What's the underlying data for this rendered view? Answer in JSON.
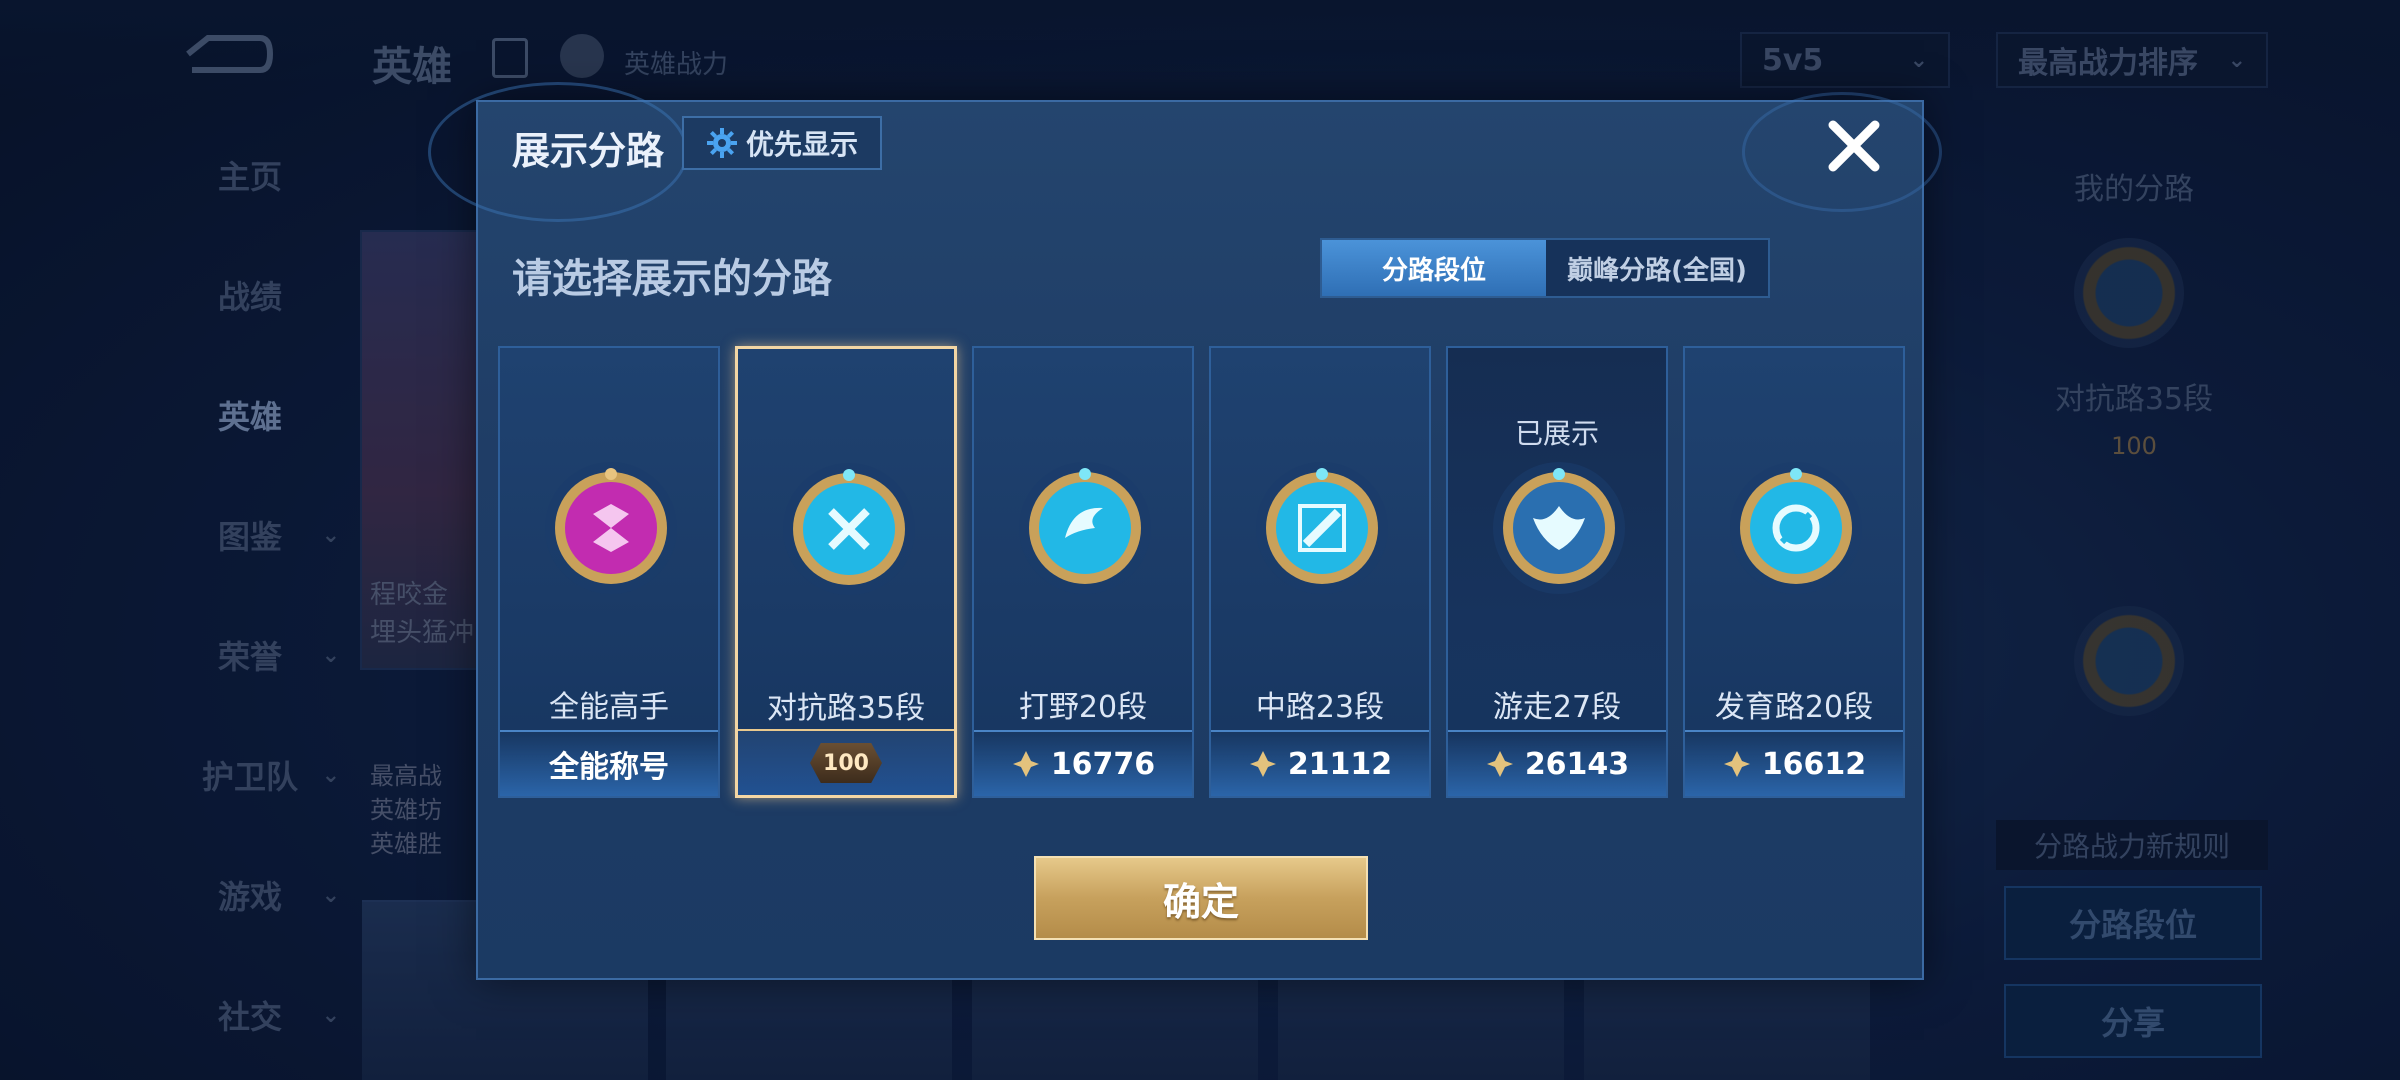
{
  "background": {
    "title": "英雄",
    "subtitle": "英雄战力",
    "mode_select": "5v5",
    "sort_select": "最高战力排序",
    "nav": [
      {
        "label": "主页",
        "has_chevron": false
      },
      {
        "label": "战绩",
        "has_chevron": false
      },
      {
        "label": "英雄",
        "has_chevron": false,
        "active": true
      },
      {
        "label": "图鉴",
        "has_chevron": true
      },
      {
        "label": "荣誉",
        "has_chevron": true
      },
      {
        "label": "护卫队",
        "has_chevron": true
      },
      {
        "label": "游戏",
        "has_chevron": true
      },
      {
        "label": "社交",
        "has_chevron": true
      }
    ],
    "hero_card_text": [
      "程咬金",
      "埋头猛冲",
      "最高战",
      "英雄坊",
      "英雄胜"
    ],
    "right_panel": {
      "title": "我的分路",
      "rank_label": "对抗路35段",
      "badge": "100",
      "note": "分路战力新规则",
      "btn_rank": "分路段位",
      "btn_share": "分享"
    }
  },
  "modal": {
    "title": "展示分路",
    "priority_button": "优先显示",
    "prompt": "请选择展示的分路",
    "tabs": [
      {
        "label": "分路段位",
        "active": true
      },
      {
        "label": "巅峰分路(全国)",
        "active": false
      }
    ],
    "cards": [
      {
        "name": "全能高手",
        "value": "全能称号",
        "status": "",
        "selected": false,
        "type": "title",
        "medal_color": "#c22cb0"
      },
      {
        "name": "对抗路35段",
        "value": "100",
        "status": "",
        "selected": true,
        "type": "badge",
        "medal_color": "#22b8e6"
      },
      {
        "name": "打野20段",
        "value": "16776",
        "status": "",
        "selected": false,
        "type": "score",
        "medal_color": "#22b8e6"
      },
      {
        "name": "中路23段",
        "value": "21112",
        "status": "",
        "selected": false,
        "type": "score",
        "medal_color": "#22b8e6"
      },
      {
        "name": "游走27段",
        "value": "26143",
        "status": "已展示",
        "selected": false,
        "type": "score",
        "medal_color": "#22b8e6"
      },
      {
        "name": "发育路20段",
        "value": "16612",
        "status": "",
        "selected": false,
        "type": "score",
        "medal_color": "#22b8e6"
      }
    ],
    "confirm_button": "确定"
  },
  "colors": {
    "accent_blue": "#2f6fb5",
    "gold": "#c7a15d",
    "selected_border": "#f3d6a4"
  }
}
